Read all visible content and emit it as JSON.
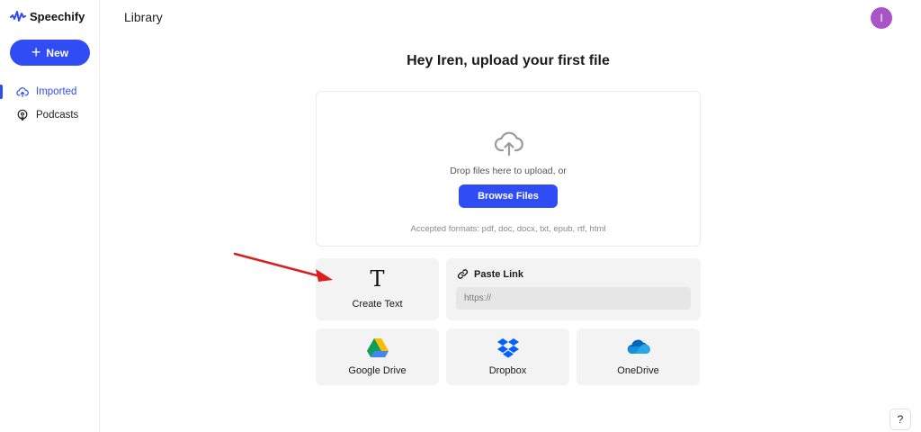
{
  "app": {
    "name": "Speechify"
  },
  "sidebar": {
    "new_label": "New",
    "items": [
      {
        "label": "Imported",
        "icon": "cloud-upload-icon",
        "active": true
      },
      {
        "label": "Podcasts",
        "icon": "podcast-icon",
        "active": false
      }
    ]
  },
  "header": {
    "title": "Library",
    "avatar_initial": "I"
  },
  "main": {
    "headline": "Hey Iren, upload your first file",
    "upload": {
      "drop_text": "Drop files here to upload, or",
      "browse_label": "Browse Files",
      "formats": "Accepted formats: pdf, doc, docx, txt, epub, rtf, html"
    },
    "create_text": {
      "glyph": "T",
      "label": "Create Text"
    },
    "paste_link": {
      "label": "Paste Link",
      "placeholder": "https://"
    },
    "services": [
      {
        "label": "Google Drive",
        "icon": "google-drive-icon"
      },
      {
        "label": "Dropbox",
        "icon": "dropbox-icon"
      },
      {
        "label": "OneDrive",
        "icon": "onedrive-icon"
      }
    ]
  },
  "help": {
    "label": "?"
  },
  "colors": {
    "accent": "#2f4cf5",
    "avatar": "#a855c7",
    "annotation_arrow": "#d9201c"
  }
}
